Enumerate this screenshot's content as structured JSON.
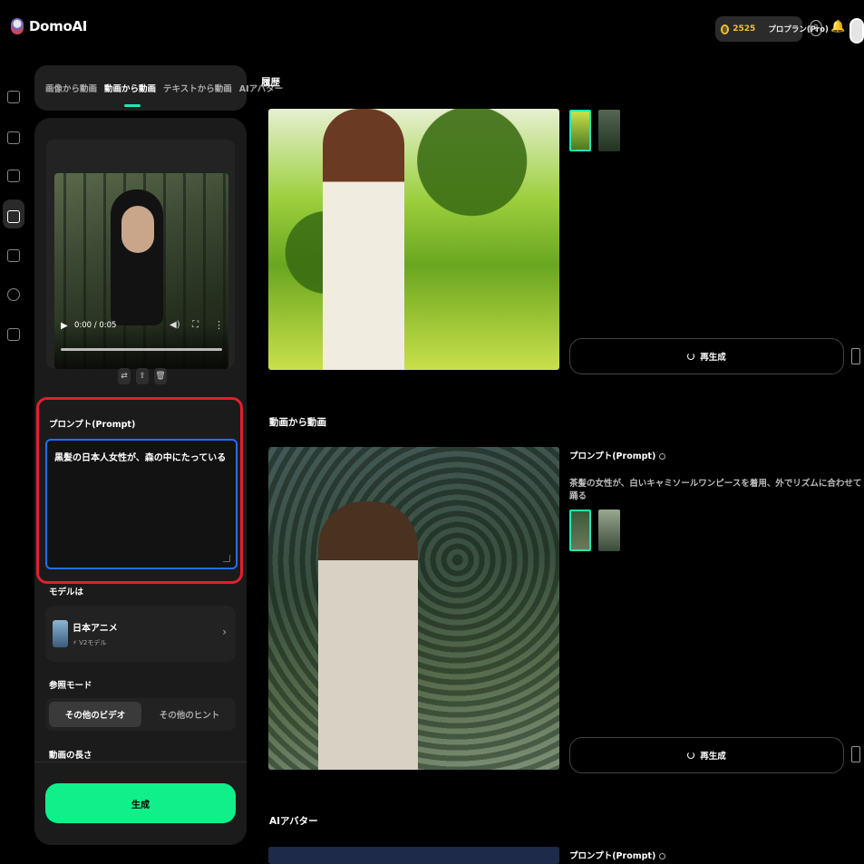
{
  "header": {
    "app_name": "DomoAI",
    "credits": "2525",
    "plan": "プロプラン(Pro)",
    "help_icon": "?"
  },
  "tabs": [
    {
      "label": "画像から動画"
    },
    {
      "label": "動画から動画",
      "active": true
    },
    {
      "label": "テキストから動画"
    },
    {
      "label": "AIアバター"
    }
  ],
  "video": {
    "time": "0:00 / 0:05"
  },
  "prompt": {
    "label": "プロンプト(Prompt)",
    "value": "黒髪の日本人女性が、森の中にたっている"
  },
  "model": {
    "label": "モデルは",
    "name": "日本アニメ",
    "sub": "V2モデル"
  },
  "reference": {
    "label": "参照モード",
    "options": [
      "その他のビデオ",
      "その他のヒント"
    ],
    "selected": "その他のビデオ"
  },
  "length": {
    "label": "動画の長さ"
  },
  "generate_label": "生成",
  "history": {
    "title": "履歴",
    "regen_label": "再生成"
  },
  "video2video_section": {
    "title": "動画から動画",
    "prompt_label": "プロンプト(Prompt)",
    "prompt_text": "茶髪の女性が、白いキャミソールワンピースを着用、外でリズムに合わせて踊る",
    "regen_label": "再生成"
  },
  "avatar_section": {
    "title": "AIアバター",
    "prompt_label": "プロンプト(Prompt)"
  },
  "colors": {
    "accent": "#1de9b6",
    "generate_button": "#0ff08a",
    "highlight": "#e1202d",
    "focus": "#1e6fff"
  }
}
